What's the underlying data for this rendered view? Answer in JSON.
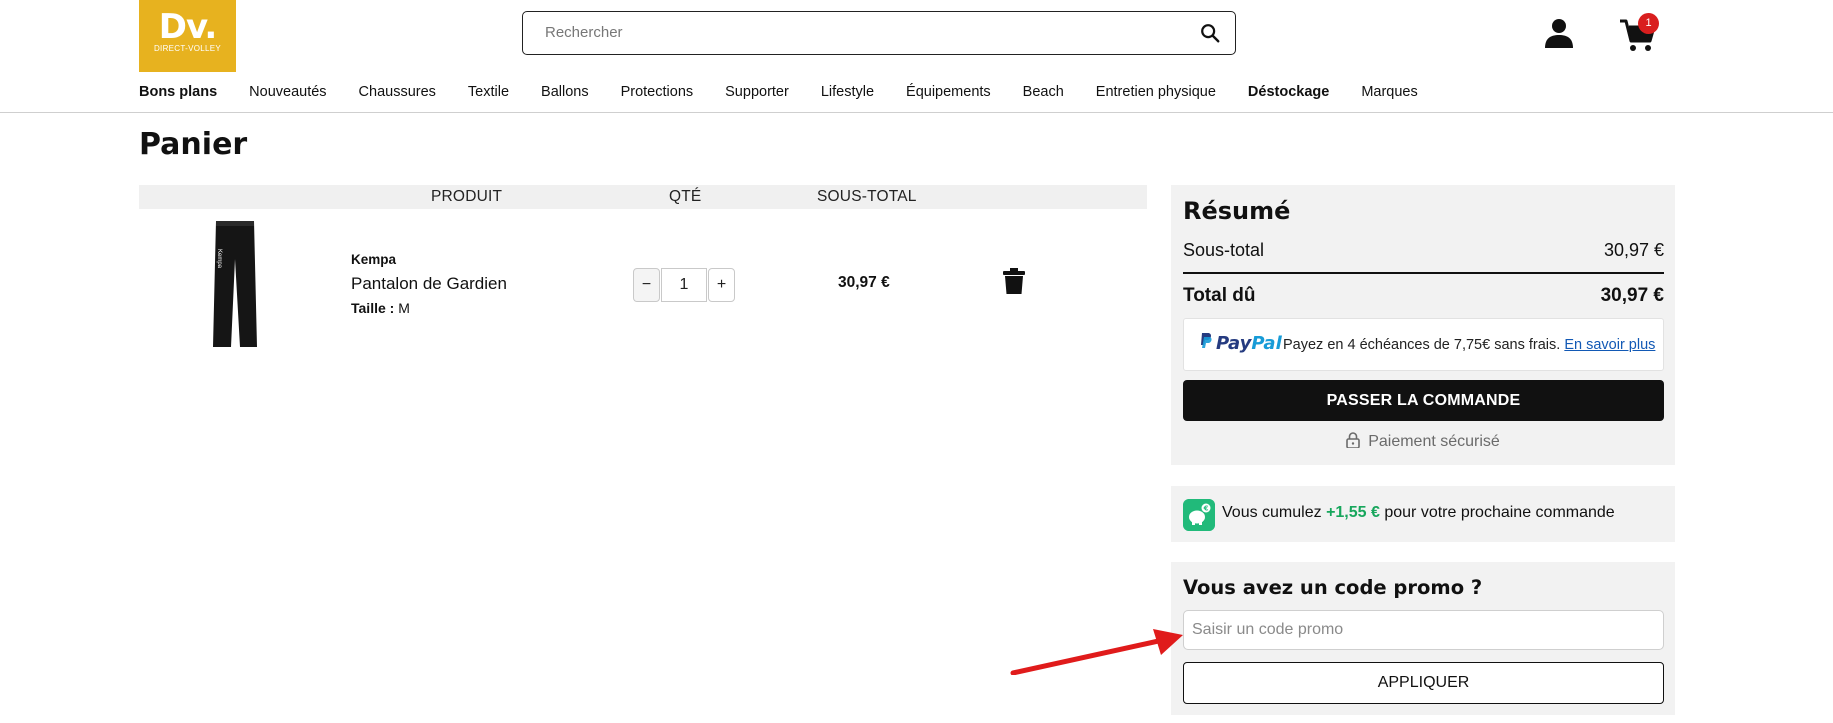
{
  "header": {
    "logo": {
      "main": "Dv.",
      "sub": "DIRECT-VOLLEY"
    },
    "search_placeholder": "Rechercher",
    "cart_count": "1"
  },
  "nav": {
    "items": [
      {
        "label": "Bons plans"
      },
      {
        "label": "Nouveautés"
      },
      {
        "label": "Chaussures"
      },
      {
        "label": "Textile"
      },
      {
        "label": "Ballons"
      },
      {
        "label": "Protections"
      },
      {
        "label": "Supporter"
      },
      {
        "label": "Lifestyle"
      },
      {
        "label": "Équipements"
      },
      {
        "label": "Beach"
      },
      {
        "label": "Entretien physique"
      },
      {
        "label": "Déstockage"
      },
      {
        "label": "Marques"
      }
    ]
  },
  "page": {
    "title": "Panier"
  },
  "cart": {
    "columns": {
      "product": "PRODUIT",
      "qty": "QTÉ",
      "subtotal": "SOUS-TOTAL"
    },
    "item": {
      "brand": "Kempa",
      "name": "Pantalon de Gardien",
      "size_label": "Taille :",
      "size_value": "M",
      "qty_minus": "−",
      "qty_value": "1",
      "qty_plus": "+",
      "subtotal": "30,97 €"
    }
  },
  "summary": {
    "title": "Résumé",
    "subtotal_label": "Sous-total",
    "subtotal_value": "30,97 €",
    "total_label": "Total dû",
    "total_value": "30,97 €",
    "paypal": {
      "logo_a": "Pay",
      "logo_b": "Pal",
      "text": "Payez en 4 échéances de 7,75€ sans frais.",
      "link": "En savoir plus"
    },
    "checkout_label": "PASSER LA COMMANDE",
    "secure_label": "Paiement sécurisé"
  },
  "cashback": {
    "prefix": "Vous cumulez",
    "amount": "+1,55 €",
    "suffix": "pour votre prochaine commande"
  },
  "promo": {
    "title": "Vous avez un code promo ?",
    "placeholder": "Saisir un code promo",
    "apply_label": "APPLIQUER"
  },
  "colors": {
    "logo_bg": "#e7b21f",
    "badge": "#d91e1e",
    "cashback_green": "#17a65c",
    "annotation_arrow": "#e01b1b"
  }
}
